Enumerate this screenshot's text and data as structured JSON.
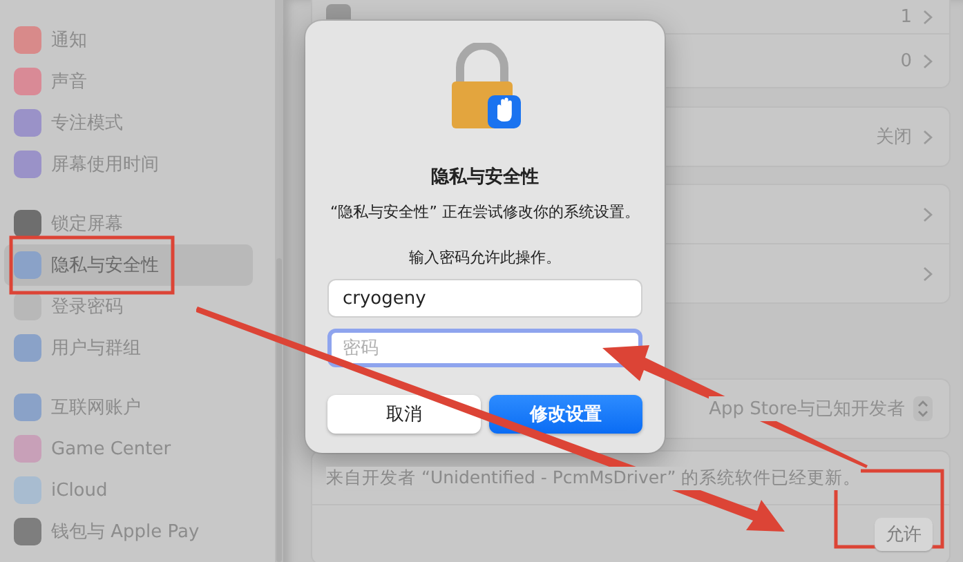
{
  "sidebar": {
    "groups": [
      {
        "items": [
          {
            "label": "通知",
            "color": "#d88a8a",
            "selected": false
          },
          {
            "label": "声音",
            "color": "#d98a96",
            "selected": false
          },
          {
            "label": "专注模式",
            "color": "#9a92c8",
            "selected": false
          },
          {
            "label": "屏幕使用时间",
            "color": "#9a92c8",
            "selected": false
          }
        ]
      },
      {
        "items": [
          {
            "label": "锁定屏幕",
            "color": "#6e6e6e",
            "selected": false
          },
          {
            "label": "隐私与安全性",
            "color": "#8aa2c8",
            "selected": true
          },
          {
            "label": "登录密码",
            "color": "#b8b8b8",
            "selected": false
          },
          {
            "label": "用户与群组",
            "color": "#8aa2c8",
            "selected": false
          }
        ]
      },
      {
        "items": [
          {
            "label": "互联网账户",
            "color": "#8aa2c8",
            "selected": false
          },
          {
            "label": "Game Center",
            "color": "#c8a0b8",
            "selected": false
          },
          {
            "label": "iCloud",
            "color": "#a8bcd0",
            "selected": false
          },
          {
            "label": "钱包与 Apple Pay",
            "color": "#7e7e7e",
            "selected": false
          }
        ]
      }
    ]
  },
  "cards": [
    {
      "rows": [
        {
          "kind": "icon_link",
          "value": "1"
        },
        {
          "kind": "link",
          "value": "0"
        }
      ]
    },
    {
      "rows": [
        {
          "kind": "link",
          "value": "关闭"
        }
      ]
    },
    {
      "rows": [
        {
          "kind": "link"
        },
        {
          "kind": "link"
        }
      ]
    },
    {
      "rows": [
        {
          "kind": "popup",
          "value": "App Store与已知开发者"
        }
      ]
    },
    {
      "rows": [
        {
          "kind": "text",
          "label": "来自开发者 “Unidentified - PcmMsDriver” 的系统软件已经更新。"
        },
        {
          "kind": "button",
          "value": "允许"
        }
      ]
    }
  ],
  "dialog": {
    "title": "隐私与安全性",
    "message": "“隐私与安全性” 正在尝试修改你的系统设置。",
    "prompt": "输入密码允许此操作。",
    "fields": [
      {
        "value": "cryogeny",
        "focused": false
      },
      {
        "placeholder": "密码",
        "focused": true
      }
    ],
    "buttons": [
      {
        "label": "取消",
        "primary": false
      },
      {
        "label": "修改设置",
        "primary": true
      }
    ]
  }
}
